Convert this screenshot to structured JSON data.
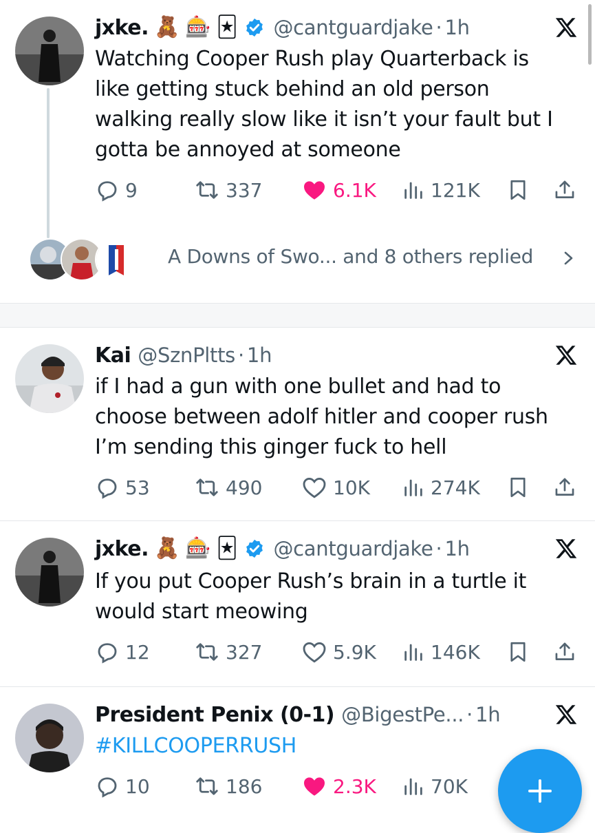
{
  "tweets": [
    {
      "name": "jxke.",
      "emojis": [
        "🧸",
        "🎰",
        "🃏"
      ],
      "verified": true,
      "handle": "@cantguardjake",
      "sep": "·",
      "time": "1h",
      "text": "Watching Cooper Rush play Quarterback is like getting stuck behind an old person walking really slow like it isn’t your fault but I gotta be annoyed at someone",
      "replies": "9",
      "retweets": "337",
      "likes": "6.1K",
      "liked": true,
      "views": "121K",
      "replied_summary": "A Downs of Swo... and 8 others replied"
    },
    {
      "name": "Kai",
      "handle": "@SznPltts",
      "sep": "·",
      "time": "1h",
      "text": "if I had a gun with one bullet and had to choose between adolf hitler and cooper rush I’m sending this ginger fuck to hell",
      "replies": "53",
      "retweets": "490",
      "likes": "10K",
      "liked": false,
      "views": "274K"
    },
    {
      "name": "jxke.",
      "emojis": [
        "🧸",
        "🎰",
        "🃏"
      ],
      "verified": true,
      "handle": "@cantguardjake",
      "sep": "·",
      "time": "1h",
      "text": "If you put Cooper Rush’s brain in a turtle it would start meowing",
      "replies": "12",
      "retweets": "327",
      "likes": "5.9K",
      "liked": false,
      "views": "146K"
    },
    {
      "name": "President Penix (0-1)",
      "handle": "@BigestPe...",
      "sep": "·",
      "time": "1h",
      "text": "#KILLCOOPERRUSH",
      "replies": "10",
      "retweets": "186",
      "likes": "2.3K",
      "liked": true,
      "views": "70K"
    }
  ],
  "colors": {
    "accent": "#1d9bf0",
    "like": "#f91880",
    "muted": "#536471"
  },
  "fab": {
    "icon": "plus-icon"
  }
}
